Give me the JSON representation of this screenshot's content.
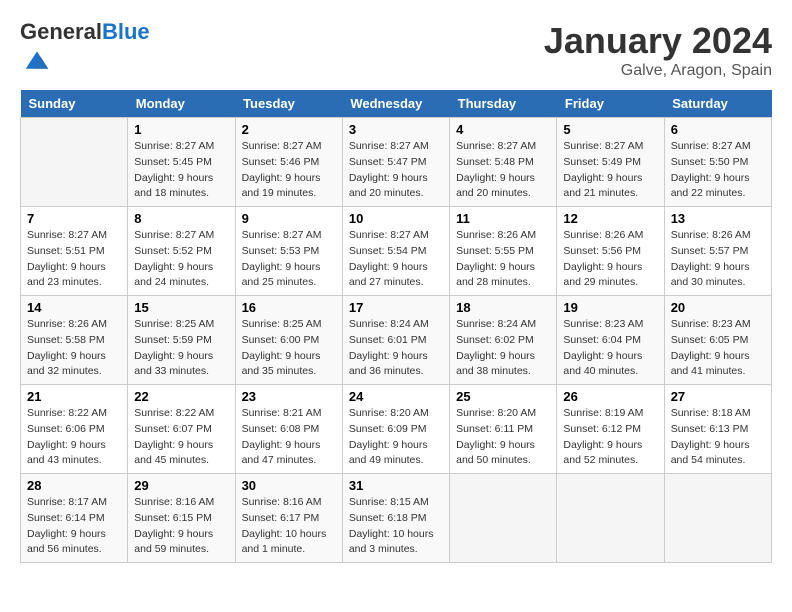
{
  "header": {
    "logo_general": "General",
    "logo_blue": "Blue",
    "title": "January 2024",
    "location": "Galve, Aragon, Spain"
  },
  "weekdays": [
    "Sunday",
    "Monday",
    "Tuesday",
    "Wednesday",
    "Thursday",
    "Friday",
    "Saturday"
  ],
  "weeks": [
    [
      {
        "day": "",
        "sunrise": "",
        "sunset": "",
        "daylight": ""
      },
      {
        "day": "1",
        "sunrise": "Sunrise: 8:27 AM",
        "sunset": "Sunset: 5:45 PM",
        "daylight": "Daylight: 9 hours and 18 minutes."
      },
      {
        "day": "2",
        "sunrise": "Sunrise: 8:27 AM",
        "sunset": "Sunset: 5:46 PM",
        "daylight": "Daylight: 9 hours and 19 minutes."
      },
      {
        "day": "3",
        "sunrise": "Sunrise: 8:27 AM",
        "sunset": "Sunset: 5:47 PM",
        "daylight": "Daylight: 9 hours and 20 minutes."
      },
      {
        "day": "4",
        "sunrise": "Sunrise: 8:27 AM",
        "sunset": "Sunset: 5:48 PM",
        "daylight": "Daylight: 9 hours and 20 minutes."
      },
      {
        "day": "5",
        "sunrise": "Sunrise: 8:27 AM",
        "sunset": "Sunset: 5:49 PM",
        "daylight": "Daylight: 9 hours and 21 minutes."
      },
      {
        "day": "6",
        "sunrise": "Sunrise: 8:27 AM",
        "sunset": "Sunset: 5:50 PM",
        "daylight": "Daylight: 9 hours and 22 minutes."
      }
    ],
    [
      {
        "day": "7",
        "sunrise": "Sunrise: 8:27 AM",
        "sunset": "Sunset: 5:51 PM",
        "daylight": "Daylight: 9 hours and 23 minutes."
      },
      {
        "day": "8",
        "sunrise": "Sunrise: 8:27 AM",
        "sunset": "Sunset: 5:52 PM",
        "daylight": "Daylight: 9 hours and 24 minutes."
      },
      {
        "day": "9",
        "sunrise": "Sunrise: 8:27 AM",
        "sunset": "Sunset: 5:53 PM",
        "daylight": "Daylight: 9 hours and 25 minutes."
      },
      {
        "day": "10",
        "sunrise": "Sunrise: 8:27 AM",
        "sunset": "Sunset: 5:54 PM",
        "daylight": "Daylight: 9 hours and 27 minutes."
      },
      {
        "day": "11",
        "sunrise": "Sunrise: 8:26 AM",
        "sunset": "Sunset: 5:55 PM",
        "daylight": "Daylight: 9 hours and 28 minutes."
      },
      {
        "day": "12",
        "sunrise": "Sunrise: 8:26 AM",
        "sunset": "Sunset: 5:56 PM",
        "daylight": "Daylight: 9 hours and 29 minutes."
      },
      {
        "day": "13",
        "sunrise": "Sunrise: 8:26 AM",
        "sunset": "Sunset: 5:57 PM",
        "daylight": "Daylight: 9 hours and 30 minutes."
      }
    ],
    [
      {
        "day": "14",
        "sunrise": "Sunrise: 8:26 AM",
        "sunset": "Sunset: 5:58 PM",
        "daylight": "Daylight: 9 hours and 32 minutes."
      },
      {
        "day": "15",
        "sunrise": "Sunrise: 8:25 AM",
        "sunset": "Sunset: 5:59 PM",
        "daylight": "Daylight: 9 hours and 33 minutes."
      },
      {
        "day": "16",
        "sunrise": "Sunrise: 8:25 AM",
        "sunset": "Sunset: 6:00 PM",
        "daylight": "Daylight: 9 hours and 35 minutes."
      },
      {
        "day": "17",
        "sunrise": "Sunrise: 8:24 AM",
        "sunset": "Sunset: 6:01 PM",
        "daylight": "Daylight: 9 hours and 36 minutes."
      },
      {
        "day": "18",
        "sunrise": "Sunrise: 8:24 AM",
        "sunset": "Sunset: 6:02 PM",
        "daylight": "Daylight: 9 hours and 38 minutes."
      },
      {
        "day": "19",
        "sunrise": "Sunrise: 8:23 AM",
        "sunset": "Sunset: 6:04 PM",
        "daylight": "Daylight: 9 hours and 40 minutes."
      },
      {
        "day": "20",
        "sunrise": "Sunrise: 8:23 AM",
        "sunset": "Sunset: 6:05 PM",
        "daylight": "Daylight: 9 hours and 41 minutes."
      }
    ],
    [
      {
        "day": "21",
        "sunrise": "Sunrise: 8:22 AM",
        "sunset": "Sunset: 6:06 PM",
        "daylight": "Daylight: 9 hours and 43 minutes."
      },
      {
        "day": "22",
        "sunrise": "Sunrise: 8:22 AM",
        "sunset": "Sunset: 6:07 PM",
        "daylight": "Daylight: 9 hours and 45 minutes."
      },
      {
        "day": "23",
        "sunrise": "Sunrise: 8:21 AM",
        "sunset": "Sunset: 6:08 PM",
        "daylight": "Daylight: 9 hours and 47 minutes."
      },
      {
        "day": "24",
        "sunrise": "Sunrise: 8:20 AM",
        "sunset": "Sunset: 6:09 PM",
        "daylight": "Daylight: 9 hours and 49 minutes."
      },
      {
        "day": "25",
        "sunrise": "Sunrise: 8:20 AM",
        "sunset": "Sunset: 6:11 PM",
        "daylight": "Daylight: 9 hours and 50 minutes."
      },
      {
        "day": "26",
        "sunrise": "Sunrise: 8:19 AM",
        "sunset": "Sunset: 6:12 PM",
        "daylight": "Daylight: 9 hours and 52 minutes."
      },
      {
        "day": "27",
        "sunrise": "Sunrise: 8:18 AM",
        "sunset": "Sunset: 6:13 PM",
        "daylight": "Daylight: 9 hours and 54 minutes."
      }
    ],
    [
      {
        "day": "28",
        "sunrise": "Sunrise: 8:17 AM",
        "sunset": "Sunset: 6:14 PM",
        "daylight": "Daylight: 9 hours and 56 minutes."
      },
      {
        "day": "29",
        "sunrise": "Sunrise: 8:16 AM",
        "sunset": "Sunset: 6:15 PM",
        "daylight": "Daylight: 9 hours and 59 minutes."
      },
      {
        "day": "30",
        "sunrise": "Sunrise: 8:16 AM",
        "sunset": "Sunset: 6:17 PM",
        "daylight": "Daylight: 10 hours and 1 minute."
      },
      {
        "day": "31",
        "sunrise": "Sunrise: 8:15 AM",
        "sunset": "Sunset: 6:18 PM",
        "daylight": "Daylight: 10 hours and 3 minutes."
      },
      {
        "day": "",
        "sunrise": "",
        "sunset": "",
        "daylight": ""
      },
      {
        "day": "",
        "sunrise": "",
        "sunset": "",
        "daylight": ""
      },
      {
        "day": "",
        "sunrise": "",
        "sunset": "",
        "daylight": ""
      }
    ]
  ]
}
